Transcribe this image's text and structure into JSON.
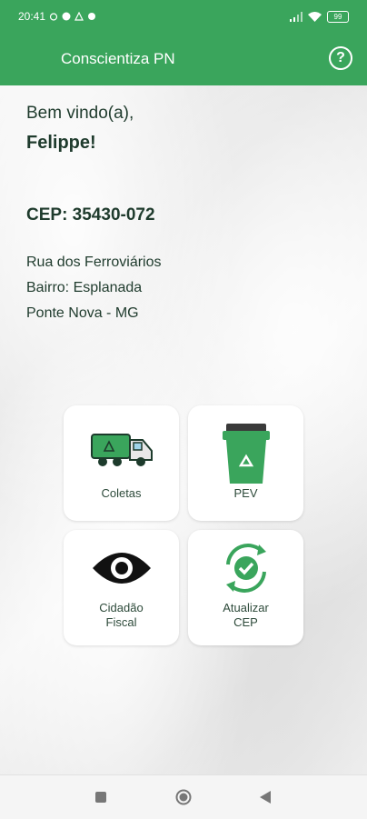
{
  "status_bar": {
    "time": "20:41",
    "battery": "99"
  },
  "app_bar": {
    "title": "Conscientiza PN",
    "help_label": "?"
  },
  "greeting": {
    "welcome": "Bem vindo(a),",
    "name": "Felippe!"
  },
  "location": {
    "cep": "CEP: 35430-072",
    "street": "Rua dos Ferroviários",
    "district": "Bairro: Esplanada",
    "city": "Ponte Nova - MG"
  },
  "tiles": {
    "coletas": {
      "label": "Coletas",
      "icon": "recycling-truck-icon"
    },
    "pev": {
      "label": "PEV",
      "icon": "recycle-bin-icon"
    },
    "cidadao_fiscal": {
      "line1": "Cidadão",
      "line2": "Fiscal",
      "icon": "eye-icon"
    },
    "atualizar_cep": {
      "line1": "Atualizar",
      "line2": "CEP",
      "icon": "refresh-check-icon"
    }
  },
  "colors": {
    "primary": "#3aa55c",
    "text": "#1f3b2d"
  }
}
